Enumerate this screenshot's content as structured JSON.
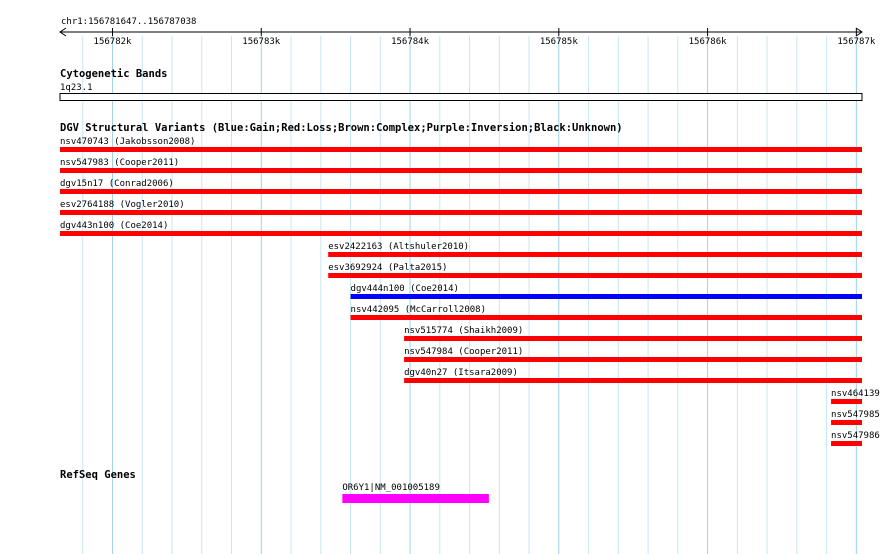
{
  "ruler": {
    "location": "chr1:156781647..156787038",
    "ticks": [
      {
        "pos": 156782000,
        "label": "156782k"
      },
      {
        "pos": 156783000,
        "label": "156783k"
      },
      {
        "pos": 156784000,
        "label": "156784k"
      },
      {
        "pos": 156785000,
        "label": "156785k"
      },
      {
        "pos": 156786000,
        "label": "156786k"
      },
      {
        "pos": 156787000,
        "label": "156787k"
      }
    ]
  },
  "view": {
    "start": 156781647,
    "end": 156787038
  },
  "tracks": {
    "cytobands": {
      "title": "Cytogenetic Bands",
      "band_label": "1q23.1"
    },
    "dgv": {
      "title": "DGV Structural Variants (Blue:Gain;Red:Loss;Brown:Complex;Purple:Inversion;Black:Unknown)",
      "colors": {
        "loss": "#ff0000",
        "gain": "#0000ff"
      },
      "features": [
        {
          "label": "nsv470743 (Jakobsson2008)",
          "start": 156781647,
          "end": 156787038,
          "type": "loss"
        },
        {
          "label": "nsv547983 (Cooper2011)",
          "start": 156781647,
          "end": 156787038,
          "type": "loss"
        },
        {
          "label": "dgv15n17 (Conrad2006)",
          "start": 156781647,
          "end": 156787038,
          "type": "loss"
        },
        {
          "label": "esv2764188 (Vogler2010)",
          "start": 156781647,
          "end": 156787038,
          "type": "loss"
        },
        {
          "label": "dgv443n100 (Coe2014)",
          "start": 156781647,
          "end": 156787038,
          "type": "loss"
        },
        {
          "label": "esv2422163 (Altshuler2010)",
          "start": 156783450,
          "end": 156787038,
          "type": "loss"
        },
        {
          "label": "esv3692924 (Palta2015)",
          "start": 156783450,
          "end": 156787038,
          "type": "loss"
        },
        {
          "label": "dgv444n100 (Coe2014)",
          "start": 156783600,
          "end": 156787038,
          "type": "gain"
        },
        {
          "label": "nsv442095 (McCarroll2008)",
          "start": 156783600,
          "end": 156787038,
          "type": "loss"
        },
        {
          "label": "nsv515774 (Shaikh2009)",
          "start": 156783960,
          "end": 156787038,
          "type": "loss"
        },
        {
          "label": "nsv547984 (Cooper2011)",
          "start": 156783960,
          "end": 156787038,
          "type": "loss"
        },
        {
          "label": "dgv40n27 (Itsara2009)",
          "start": 156783960,
          "end": 156787038,
          "type": "loss"
        },
        {
          "label": "nsv464139",
          "start": 156786830,
          "end": 156787050,
          "type": "loss"
        },
        {
          "label": "nsv547985",
          "start": 156786830,
          "end": 156787050,
          "type": "loss"
        },
        {
          "label": "nsv547986",
          "start": 156786830,
          "end": 156787050,
          "type": "loss"
        }
      ]
    },
    "refseq": {
      "title": "RefSeq Genes",
      "color": "#ff00ff",
      "features": [
        {
          "label": "OR6Y1|NM_001005189",
          "start": 156783545,
          "end": 156784530
        }
      ]
    }
  }
}
